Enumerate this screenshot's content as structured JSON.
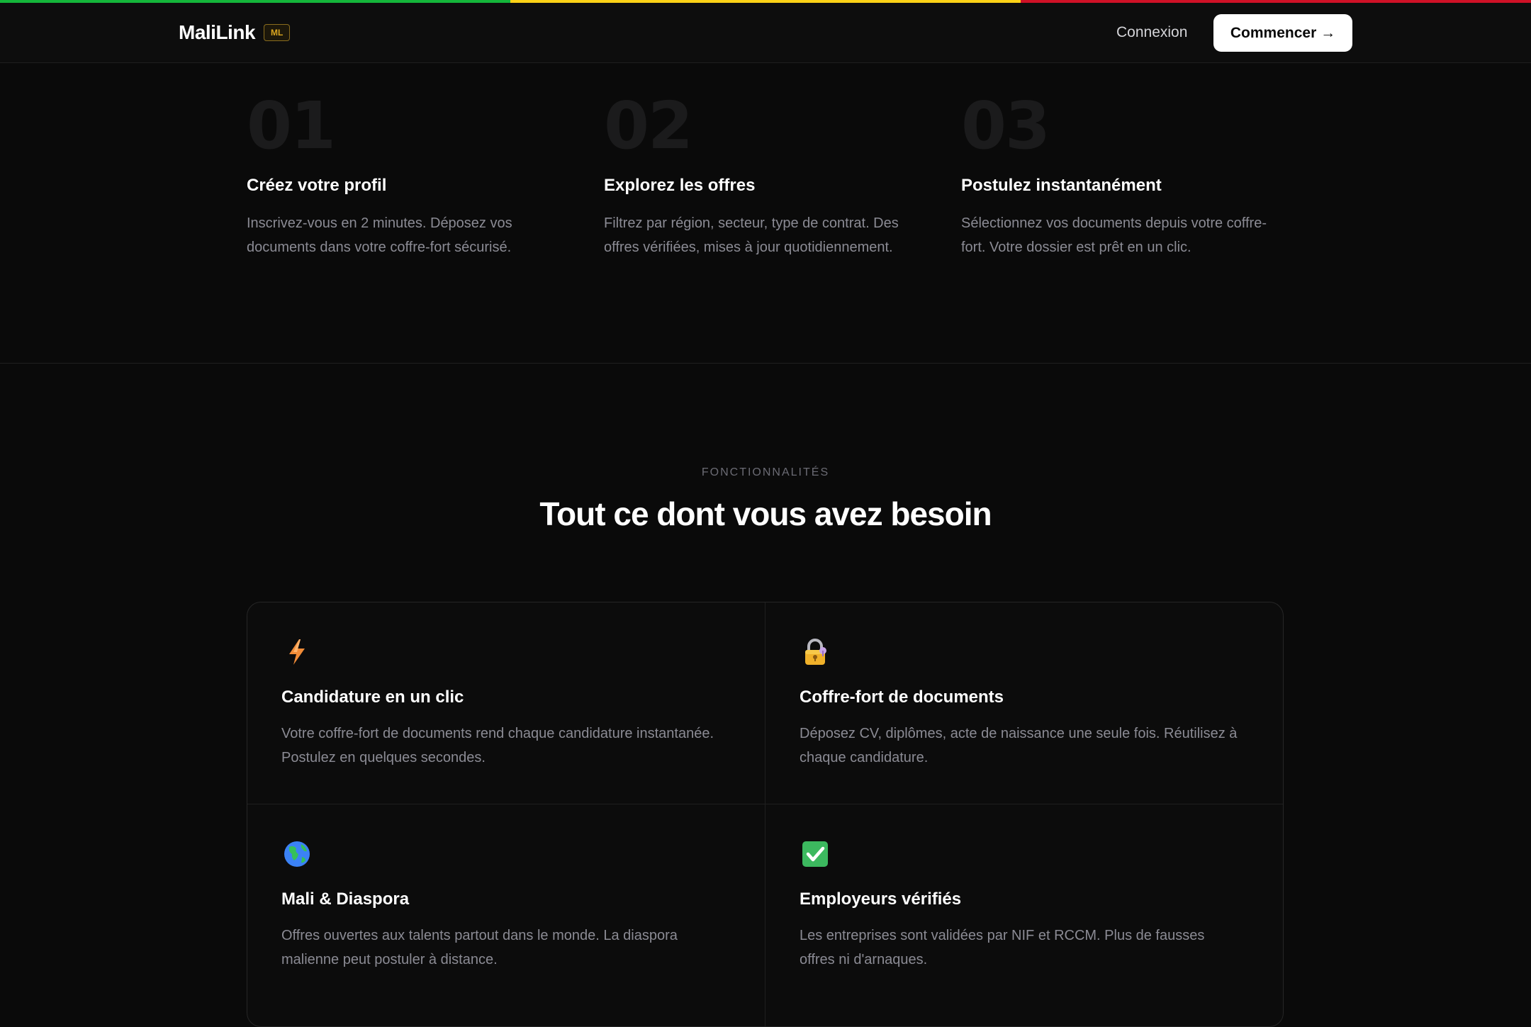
{
  "colors": {
    "flag_green": "#14b53a",
    "flag_yellow": "#fcd116",
    "flag_red": "#ce1126",
    "background": "#0a0a0a",
    "muted_text": "#8b8b94",
    "brand_badge": "#d9a520"
  },
  "header": {
    "brand": "MaliLink",
    "badge": "ML",
    "login": "Connexion",
    "cta": "Commencer →"
  },
  "steps": [
    {
      "number": "01",
      "title": "Créez votre profil",
      "desc": "Inscrivez-vous en 2 minutes. Déposez vos documents dans votre coffre-fort sécurisé."
    },
    {
      "number": "02",
      "title": "Explorez les offres",
      "desc": "Filtrez par région, secteur, type de contrat. Des offres vérifiées, mises à jour quotidiennement."
    },
    {
      "number": "03",
      "title": "Postulez instantanément",
      "desc": "Sélectionnez vos documents depuis votre coffre-fort. Votre dossier est prêt en un clic."
    }
  ],
  "features": {
    "eyebrow": "FONCTIONNALITÉS",
    "title": "Tout ce dont vous avez besoin",
    "items": [
      {
        "icon": "lightning-icon",
        "title": "Candidature en un clic",
        "desc": "Votre coffre-fort de documents rend chaque candidature instantanée. Postulez en quelques secondes."
      },
      {
        "icon": "lock-icon",
        "title": "Coffre-fort de documents",
        "desc": "Déposez CV, diplômes, acte de naissance une seule fois. Réutilisez à chaque candidature."
      },
      {
        "icon": "globe-icon",
        "title": "Mali & Diaspora",
        "desc": "Offres ouvertes aux talents partout dans le monde. La diaspora malienne peut postuler à distance."
      },
      {
        "icon": "checkmark-icon",
        "title": "Employeurs vérifiés",
        "desc": "Les entreprises sont validées par NIF et RCCM. Plus de fausses offres ni d'arnaques."
      }
    ]
  }
}
